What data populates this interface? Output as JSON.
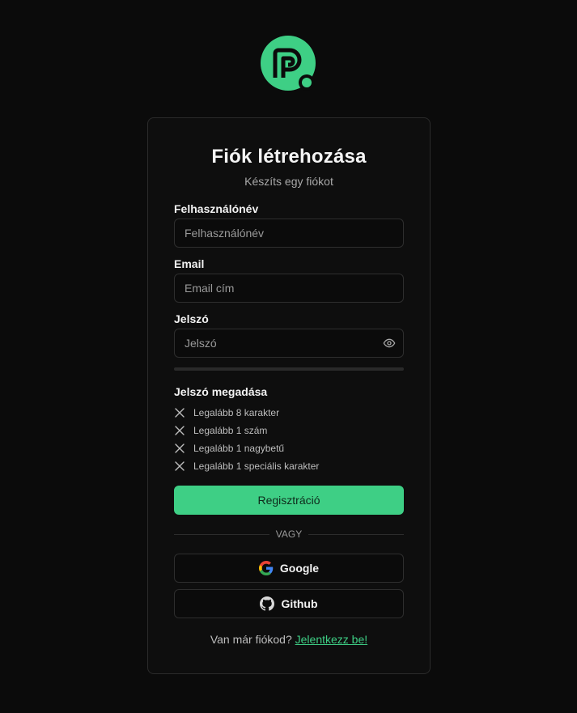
{
  "colors": {
    "accent": "#3ecf85",
    "background": "#0b0b0b",
    "border": "#2e2e2e"
  },
  "logo": {
    "icon": "brand-logo-icon"
  },
  "form": {
    "title": "Fiók létrehozása",
    "subtitle": "Készíts egy fiókot",
    "username": {
      "label": "Felhasználónév",
      "placeholder": "Felhasználónév",
      "value": ""
    },
    "email": {
      "label": "Email",
      "placeholder": "Email cím",
      "value": ""
    },
    "password": {
      "label": "Jelszó",
      "placeholder": "Jelszó",
      "value": "",
      "toggle_icon": "eye-icon"
    },
    "password_strength": 0,
    "requirements": {
      "title": "Jelszó megadása",
      "icon": "x-icon",
      "items": [
        {
          "text": "Legalább 8 karakter",
          "met": false
        },
        {
          "text": "Legalább 1 szám",
          "met": false
        },
        {
          "text": "Legalább 1 nagybetű",
          "met": false
        },
        {
          "text": "Legalább 1 speciális karakter",
          "met": false
        }
      ]
    },
    "submit_label": "Regisztráció",
    "divider_text": "VAGY",
    "social": [
      {
        "label": "Google",
        "icon": "google-icon"
      },
      {
        "label": "Github",
        "icon": "github-icon"
      }
    ],
    "footer": {
      "text": "Van már fiókod?",
      "link": "Jelentkezz be!"
    }
  }
}
